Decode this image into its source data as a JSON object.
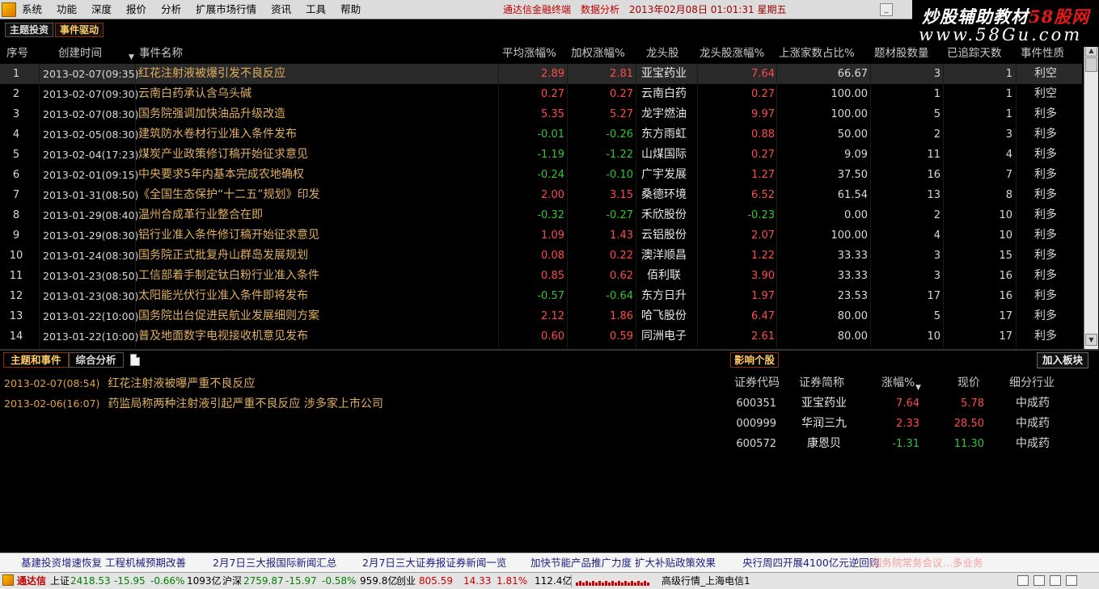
{
  "menu": [
    "系统",
    "功能",
    "深度",
    "报价",
    "分析",
    "扩展市场行情",
    "资讯",
    "工具",
    "帮助"
  ],
  "title_info": {
    "app": "通达信金融终端",
    "module": "数据分析",
    "datetime": "2013年02月08日 01:01:31 星期五"
  },
  "watermark": {
    "line1": "炒股辅助教材58股网",
    "line2": "www.58Gu.com"
  },
  "top_tabs": [
    "主题投资",
    "事件驱动"
  ],
  "columns": [
    "序号",
    "创建时间",
    "事件名称",
    "平均涨幅%",
    "加权涨幅%",
    "龙头股",
    "龙头股涨幅%",
    "上涨家数占比%",
    "题材股数量",
    "已追踪天数",
    "事件性质"
  ],
  "events": [
    {
      "idx": "1",
      "time": "2013-02-07(09:35)",
      "name": "红花注射液被爆引发不良反应",
      "avg": "2.89",
      "wavg": "2.81",
      "leader": "亚宝药业",
      "leader_chg": "7.64",
      "up_ratio": "66.67",
      "count": "3",
      "days": "1",
      "nature": "利空"
    },
    {
      "idx": "2",
      "time": "2013-02-07(09:30)",
      "name": "云南白药承认含乌头碱",
      "avg": "0.27",
      "wavg": "0.27",
      "leader": "云南白药",
      "leader_chg": "0.27",
      "up_ratio": "100.00",
      "count": "1",
      "days": "1",
      "nature": "利空"
    },
    {
      "idx": "3",
      "time": "2013-02-07(08:30)",
      "name": "国务院强调加快油品升级改造",
      "avg": "5.35",
      "wavg": "5.27",
      "leader": "龙宇燃油",
      "leader_chg": "9.97",
      "up_ratio": "100.00",
      "count": "5",
      "days": "1",
      "nature": "利多"
    },
    {
      "idx": "4",
      "time": "2013-02-05(08:30)",
      "name": "建筑防水卷材行业准入条件发布",
      "avg": "-0.01",
      "wavg": "-0.26",
      "leader": "东方雨虹",
      "leader_chg": "0.88",
      "up_ratio": "50.00",
      "count": "2",
      "days": "3",
      "nature": "利多"
    },
    {
      "idx": "5",
      "time": "2013-02-04(17:23)",
      "name": "煤炭产业政策修订稿开始征求意见",
      "avg": "-1.19",
      "wavg": "-1.22",
      "leader": "山煤国际",
      "leader_chg": "0.27",
      "up_ratio": "9.09",
      "count": "11",
      "days": "4",
      "nature": "利多"
    },
    {
      "idx": "6",
      "time": "2013-02-01(09:15)",
      "name": "中央要求5年内基本完成农地确权",
      "avg": "-0.24",
      "wavg": "-0.10",
      "leader": "广宇发展",
      "leader_chg": "1.27",
      "up_ratio": "37.50",
      "count": "16",
      "days": "7",
      "nature": "利多"
    },
    {
      "idx": "7",
      "time": "2013-01-31(08:50)",
      "name": "《全国生态保护“十二五”规划》印发",
      "avg": "2.00",
      "wavg": "3.15",
      "leader": "桑德环境",
      "leader_chg": "6.52",
      "up_ratio": "61.54",
      "count": "13",
      "days": "8",
      "nature": "利多"
    },
    {
      "idx": "8",
      "time": "2013-01-29(08:40)",
      "name": "温州合成革行业整合在即",
      "avg": "-0.32",
      "wavg": "-0.27",
      "leader": "禾欣股份",
      "leader_chg": "-0.23",
      "up_ratio": "0.00",
      "count": "2",
      "days": "10",
      "nature": "利多"
    },
    {
      "idx": "9",
      "time": "2013-01-29(08:30)",
      "name": "铝行业准入条件修订稿开始征求意见",
      "avg": "1.09",
      "wavg": "1.43",
      "leader": "云铝股份",
      "leader_chg": "2.07",
      "up_ratio": "100.00",
      "count": "4",
      "days": "10",
      "nature": "利多"
    },
    {
      "idx": "10",
      "time": "2013-01-24(08:30)",
      "name": "国务院正式批复舟山群岛发展规划",
      "avg": "0.08",
      "wavg": "0.22",
      "leader": "澳洋顺昌",
      "leader_chg": "1.22",
      "up_ratio": "33.33",
      "count": "3",
      "days": "15",
      "nature": "利多"
    },
    {
      "idx": "11",
      "time": "2013-01-23(08:50)",
      "name": "工信部着手制定钛白粉行业准入条件",
      "avg": "0.85",
      "wavg": "0.62",
      "leader": "佰利联",
      "leader_chg": "3.90",
      "up_ratio": "33.33",
      "count": "3",
      "days": "16",
      "nature": "利多"
    },
    {
      "idx": "12",
      "time": "2013-01-23(08:30)",
      "name": "太阳能光伏行业准入条件即将发布",
      "avg": "-0.57",
      "wavg": "-0.64",
      "leader": "东方日升",
      "leader_chg": "1.97",
      "up_ratio": "23.53",
      "count": "17",
      "days": "16",
      "nature": "利多"
    },
    {
      "idx": "13",
      "time": "2013-01-22(10:00)",
      "name": "国务院出台促进民航业发展细则方案",
      "avg": "2.12",
      "wavg": "1.86",
      "leader": "哈飞股份",
      "leader_chg": "6.47",
      "up_ratio": "80.00",
      "count": "5",
      "days": "17",
      "nature": "利多"
    },
    {
      "idx": "14",
      "time": "2013-01-22(10:00)",
      "name": "普及地面数字电视接收机意见发布",
      "avg": "0.60",
      "wavg": "0.59",
      "leader": "同洲电子",
      "leader_chg": "2.61",
      "up_ratio": "80.00",
      "count": "10",
      "days": "17",
      "nature": "利多"
    }
  ],
  "bottom_tabs": [
    "主题和事件",
    "综合分析"
  ],
  "news": [
    {
      "time": "2013-02-07(08:54)",
      "text": "红花注射液被曝严重不良反应"
    },
    {
      "time": "2013-02-06(16:07)",
      "text": "药监局称两种注射液引起严重不良反应 涉多家上市公司"
    }
  ],
  "stock_tab": "影响个股",
  "add_button": "加入板块",
  "stock_columns": [
    "证券代码",
    "证券简称",
    "涨幅%",
    "现价",
    "细分行业"
  ],
  "stocks": [
    {
      "code": "600351",
      "name": "亚宝药业",
      "chg": "7.64",
      "price": "5.78",
      "industry": "中成药"
    },
    {
      "code": "000999",
      "name": "华润三九",
      "chg": "2.33",
      "price": "28.50",
      "industry": "中成药"
    },
    {
      "code": "600572",
      "name": "康恩贝",
      "chg": "-1.31",
      "price": "11.30",
      "industry": "中成药"
    }
  ],
  "ticker": [
    "基建投资增速恢复 工程机械预期改善",
    "2月7日三大报国际新闻汇总",
    "2月7日三大证券报证券新闻一览",
    "加快节能产品推广力度 扩大补贴政策效果",
    "央行周四开展4100亿元逆回购",
    "国务院常务会议…多业务"
  ],
  "status": {
    "brand": "通达信",
    "sh_label": "上证",
    "sh_val": "2418.53",
    "sh_chg": "-15.95",
    "sh_pct": "-0.66%",
    "sh_amt": "1093亿",
    "sz_label": "沪深",
    "sz_val": "2759.87",
    "sz_chg": "-15.97",
    "sz_pct": "-0.58%",
    "sz_amt": "959.8亿",
    "cy_label": "创业",
    "cy_val": "805.59",
    "cy_chg": "14.33",
    "cy_pct": "1.81%",
    "cy_amt": "112.4亿",
    "server": "高级行情_上海电信1"
  }
}
